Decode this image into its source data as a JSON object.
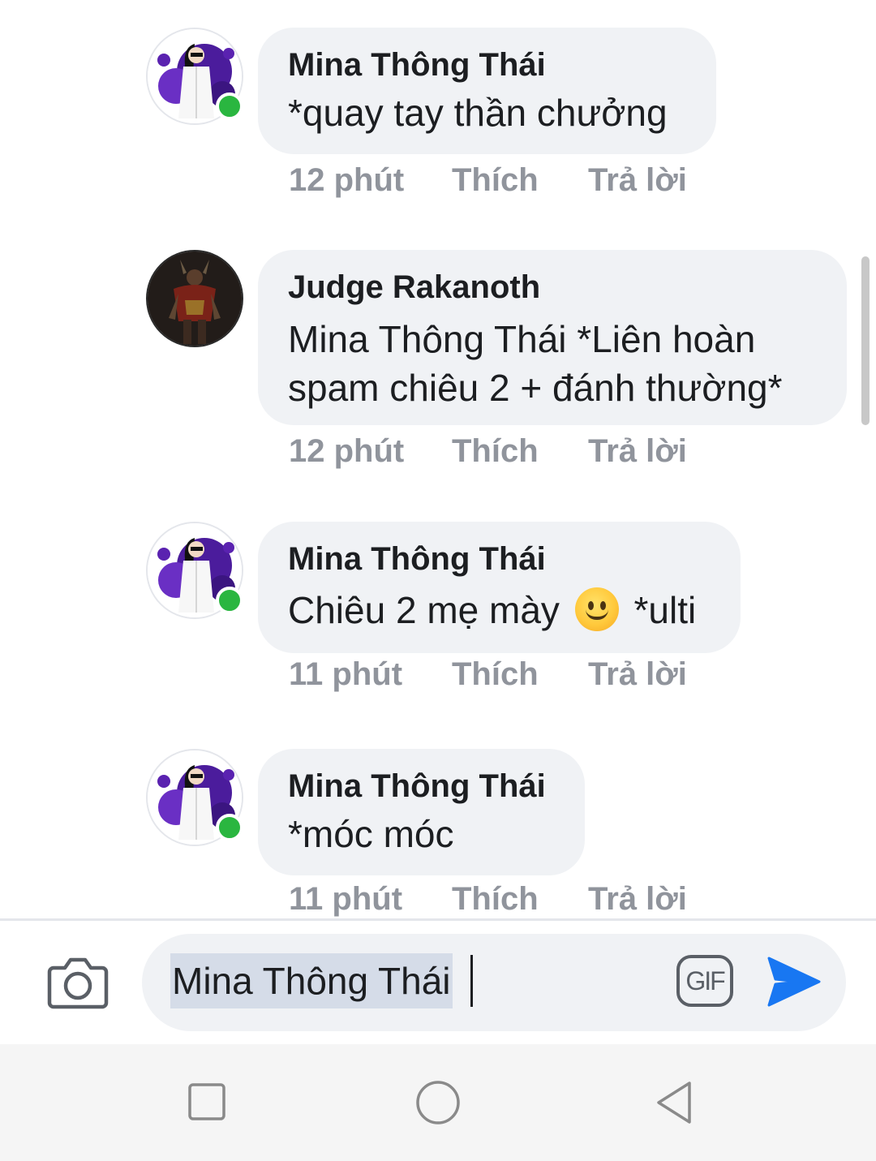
{
  "comments": [
    {
      "author": "Mina Thông Thái",
      "text": "*quay tay thần chưởng",
      "time": "12 phút",
      "like": "Thích",
      "reply": "Trả lời",
      "online": true
    },
    {
      "author": "Judge Rakanoth",
      "text_line1": "Mina Thông Thái *Liên hoàn",
      "text_line2": "spam chiêu 2 + đánh thường*",
      "time": "12 phút",
      "like": "Thích",
      "reply": "Trả lời",
      "online": false
    },
    {
      "author": "Mina Thông Thái",
      "text_before": "Chiêu 2 mẹ mày",
      "emoji": "slightly-smiling-face",
      "text_after": "*ulti",
      "time": "11 phút",
      "like": "Thích",
      "reply": "Trả lời",
      "online": true
    },
    {
      "author": "Mina Thông Thái",
      "text": "*móc móc",
      "time": "11 phút",
      "like": "Thích",
      "reply": "Trả lời",
      "online": true
    }
  ],
  "composer": {
    "input_value": "Mina Thông Thái",
    "gif_label": "GIF",
    "icons": [
      "camera-icon",
      "gif-icon",
      "send-icon"
    ],
    "accent_color": "#1877f2"
  },
  "navbar": {
    "icons": [
      "recent-apps-icon",
      "home-icon",
      "back-icon"
    ]
  }
}
